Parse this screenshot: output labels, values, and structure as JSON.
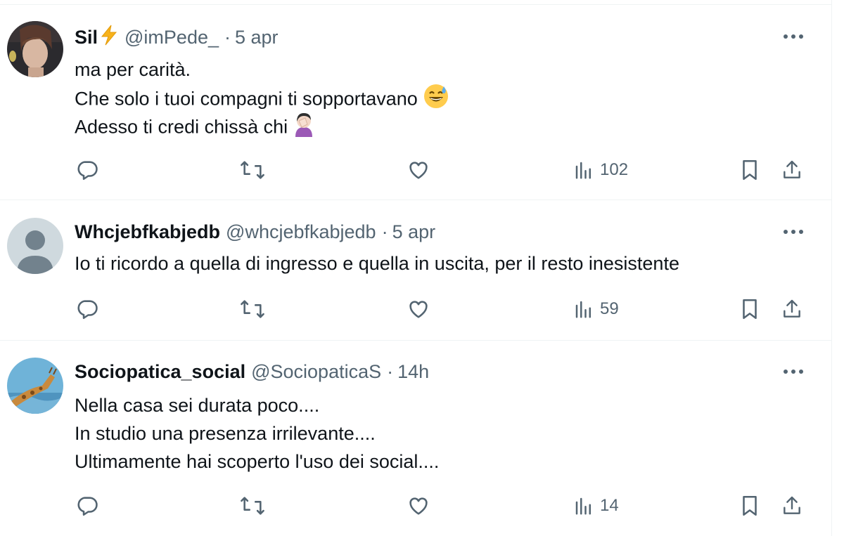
{
  "tweets": [
    {
      "name": "Sil",
      "handle": "@imPede_",
      "dot": "·",
      "time": "5 apr",
      "lines": [
        "ma per carità.",
        "Che solo i tuoi compagni ti sopportavano",
        "Adesso ti credi chissà chi"
      ],
      "views": "102"
    },
    {
      "name": "Whcjebfkabjedb",
      "handle": "@whcjebfkabjedb",
      "dot": "·",
      "time": "5 apr",
      "lines": [
        "Io ti ricordo a quella di ingresso e quella in uscita, per il resto inesistente"
      ],
      "views": "59"
    },
    {
      "name": "Sociopatica_social",
      "handle": "@SociopaticaS",
      "dot": "·",
      "time": "14h",
      "lines": [
        "Nella casa sei durata poco....",
        "In studio una presenza irrilevante....",
        "Ultimamente hai scoperto l'uso dei social...."
      ],
      "views": "14"
    }
  ],
  "colors": {
    "text": "#0f1419",
    "muted": "#536471",
    "divider": "#eff3f4"
  },
  "icons": [
    "more-icon",
    "reply-icon",
    "retweet-icon",
    "like-icon",
    "views-icon",
    "bookmark-icon",
    "share-icon",
    "lightning-emoji",
    "sweat-smile-emoji",
    "facepalm-emoji"
  ]
}
